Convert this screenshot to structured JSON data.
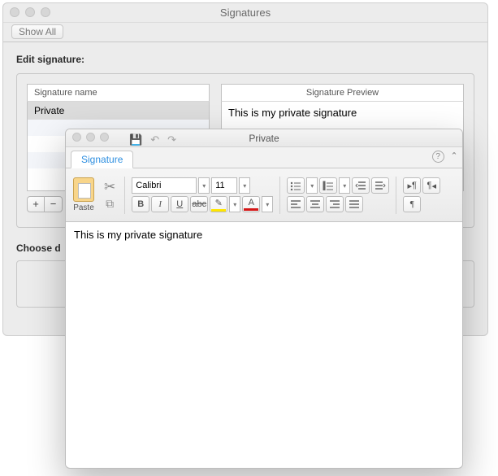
{
  "pref": {
    "title": "Signatures",
    "show_all": "Show All",
    "edit_label": "Edit signature:",
    "list_header": "Signature name",
    "list_items": [
      "Private"
    ],
    "preview_header": "Signature Preview",
    "preview_text": "This is my private signature",
    "add": "+",
    "remove": "−",
    "choose_label_truncated": "Choose d"
  },
  "editor": {
    "title": "Private",
    "tab": "Signature",
    "paste": "Paste",
    "font": "Calibri",
    "size": "11",
    "chevron": "ˆ",
    "content": "This is my private signature",
    "save_icon": "💾",
    "undo_icon": "↶",
    "redo_icon": "↷",
    "help_q": "?",
    "pilcrow": "¶",
    "A": "A",
    "pen": "✎"
  }
}
